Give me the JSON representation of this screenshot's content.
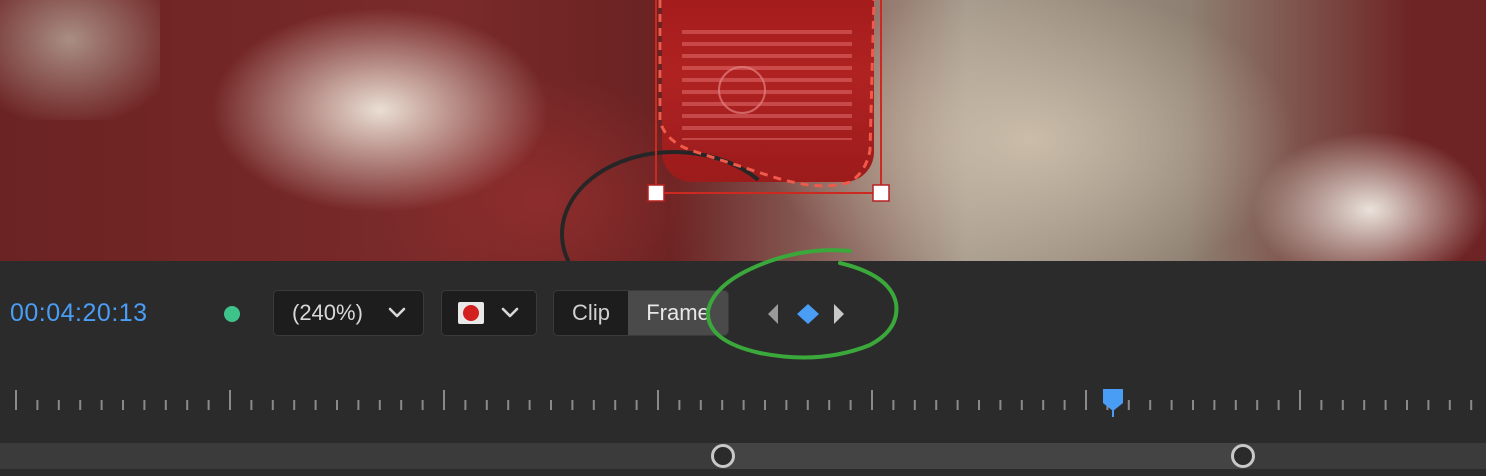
{
  "player": {
    "timecode": "00:04:20:13",
    "status": "green-dot-indicator",
    "zoom": {
      "label": "(240%)"
    },
    "mask_color": {
      "swatch_icon": "record-swatch-icon",
      "color": "#d21f1f"
    },
    "mode_toggle": {
      "clip_label": "Clip",
      "frame_label": "Frame",
      "selected": "Frame"
    },
    "keyframe_nav": {
      "prev_icon": "triangle-left-icon",
      "add_icon": "diamond-keyframe-icon",
      "next_icon": "triangle-right-icon"
    },
    "annotation": {
      "shape": "green-hand-drawn-circle",
      "color": "#3aa83a"
    }
  },
  "timeline": {
    "playhead_color": "#4a9df5"
  },
  "colors": {
    "accent": "#4a9df5",
    "status_green": "#3ec48a",
    "panel": "#2b2b2b",
    "mask_red": "#d22a2a"
  }
}
